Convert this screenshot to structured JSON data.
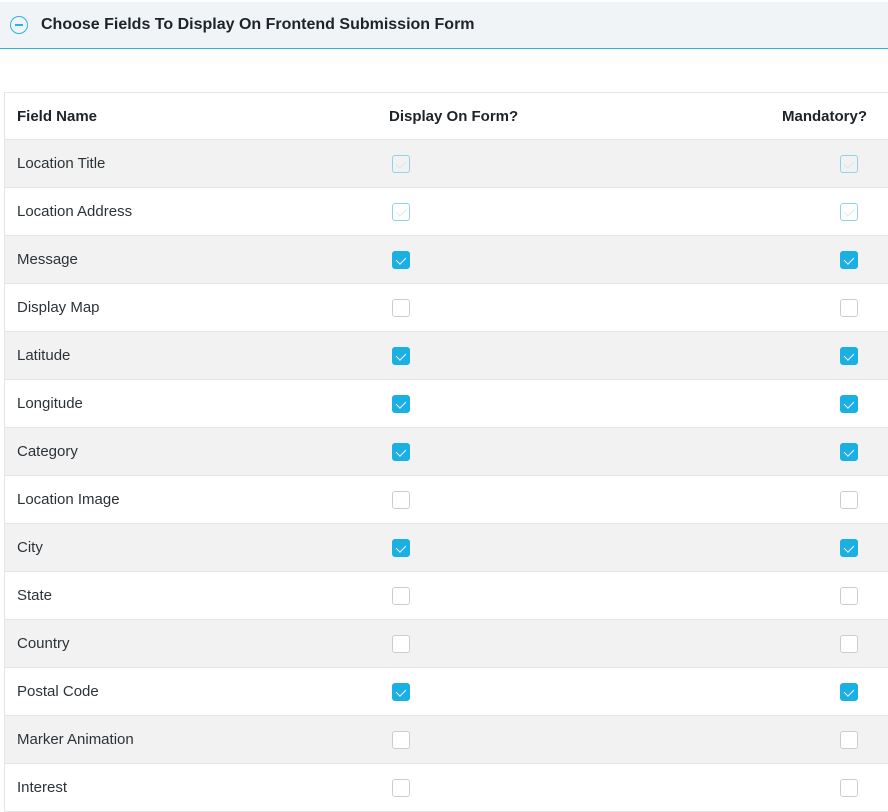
{
  "panel": {
    "title": "Choose Fields To Display On Frontend Submission Form",
    "toggle_icon": "minus-circle-icon"
  },
  "table": {
    "headers": [
      "Field Name",
      "Display On Form?",
      "Mandatory?"
    ],
    "rows": [
      {
        "name": "Location Title",
        "display": "checked-disabled",
        "mandatory": "checked-disabled"
      },
      {
        "name": "Location Address",
        "display": "checked-disabled",
        "mandatory": "checked-disabled"
      },
      {
        "name": "Message",
        "display": "checked",
        "mandatory": "checked"
      },
      {
        "name": "Display Map",
        "display": "unchecked",
        "mandatory": "unchecked"
      },
      {
        "name": "Latitude",
        "display": "checked",
        "mandatory": "checked"
      },
      {
        "name": "Longitude",
        "display": "checked",
        "mandatory": "checked"
      },
      {
        "name": "Category",
        "display": "checked",
        "mandatory": "checked"
      },
      {
        "name": "Location Image",
        "display": "unchecked",
        "mandatory": "unchecked"
      },
      {
        "name": "City",
        "display": "checked",
        "mandatory": "checked"
      },
      {
        "name": "State",
        "display": "unchecked",
        "mandatory": "unchecked"
      },
      {
        "name": "Country",
        "display": "unchecked",
        "mandatory": "unchecked"
      },
      {
        "name": "Postal Code",
        "display": "checked",
        "mandatory": "checked"
      },
      {
        "name": "Marker Animation",
        "display": "unchecked",
        "mandatory": "unchecked"
      },
      {
        "name": "Interest",
        "display": "unchecked",
        "mandatory": "unchecked"
      }
    ]
  },
  "colors": {
    "accent": "#1ab0e3",
    "header_bg": "#f1f4f7",
    "stripe_bg": "#f2f2f2"
  }
}
